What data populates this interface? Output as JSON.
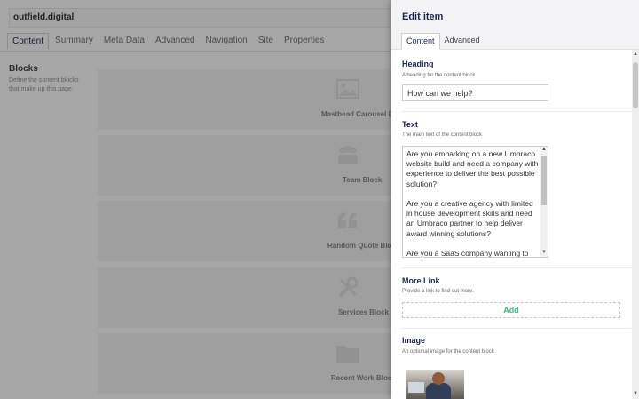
{
  "background": {
    "doc_name": "outfield.digital",
    "tabs": [
      "Content",
      "Summary",
      "Meta Data",
      "Advanced",
      "Navigation",
      "Site",
      "Properties"
    ],
    "blocks_label": "Blocks",
    "blocks_description": "Define the content blocks that make up this page.",
    "blocks": [
      {
        "name": "Masthead Carousel Block",
        "icon": "image-icon"
      },
      {
        "name": "Team Block",
        "icon": "team-icon"
      },
      {
        "name": "Random Quote Block",
        "icon": "quote-icon"
      },
      {
        "name": "Services Block",
        "icon": "tools-icon"
      },
      {
        "name": "Recent Work Block",
        "icon": "folder-icon"
      }
    ]
  },
  "panel": {
    "title": "Edit item",
    "tabs": [
      "Content",
      "Advanced"
    ],
    "heading": {
      "label": "Heading",
      "description": "A heading for the content block",
      "value": "How can we help?"
    },
    "text": {
      "label": "Text",
      "description": "The main text of the content block",
      "value": "Are you embarking on a new Umbraco website build and need a company with experience to deliver the best possible solution?\n\nAre you a creative agency with limited in house development skills and need an Umbraco partner to help deliver award winning solutions?\n\nAre you a SaaS company wanting to"
    },
    "more_link": {
      "label": "More Link",
      "description": "Provide a link to find out more.",
      "add_label": "Add"
    },
    "image": {
      "label": "Image",
      "description": "An optional image for the content block"
    }
  },
  "colors": {
    "accent_green": "#2bc37c",
    "heading_navy": "#1b264f"
  }
}
